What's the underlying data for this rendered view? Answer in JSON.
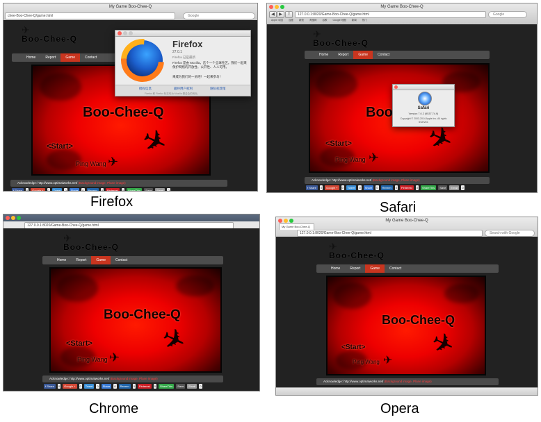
{
  "site": {
    "logo": "Boo-Chee-Q",
    "nav": [
      "Home",
      "Report",
      "Game",
      "Contact"
    ],
    "game_title": "Boo-Chee-Q",
    "start_label": "<Start>",
    "author": "Ping Wang",
    "ack_prefix": "Acknowledge: http://www.optimalworks.net/",
    "ack_suffix": "(Background image, Plane image)",
    "share_buttons": [
      {
        "label": "f Share",
        "color": "#3b5998"
      },
      {
        "label": "0",
        "color": "#eeeeee"
      },
      {
        "label": "Google +",
        "color": "#d34836"
      },
      {
        "label": "0",
        "color": "#eeeeee"
      },
      {
        "label": "Tweet",
        "color": "#3a8ed6"
      },
      {
        "label": "0",
        "color": "#eeeeee"
      },
      {
        "label": "Share",
        "color": "#3a7bd5"
      },
      {
        "label": "0",
        "color": "#eeeeee"
      },
      {
        "label": "Renren",
        "color": "#2266aa"
      },
      {
        "label": "0",
        "color": "#eeeeee"
      },
      {
        "label": "Pinterest",
        "color": "#cb2027"
      },
      {
        "label": "0",
        "color": "#eeeeee"
      },
      {
        "label": "ShareThis",
        "color": "#35a84a"
      },
      {
        "label": "Save",
        "color": "#555555"
      },
      {
        "label": "Email",
        "color": "#999999"
      },
      {
        "label": "0",
        "color": "#eeeeee"
      }
    ]
  },
  "panels": {
    "firefox": {
      "caption": "Firefox",
      "window_title": "My Game Boo-Chee-Q",
      "url": "chee-Boo-Chee-Q/game.html",
      "search_placeholder": "Google",
      "about": {
        "product": "Firefox",
        "version": "27.0.1",
        "channel": "Firefox 已是最新",
        "description": "Firefox 是由 Mozilla，这个一个全球社区。我们一起来保护网络的开放性、公开性、人人可用。",
        "join": "来成为我们的一员吧！一起来参与！",
        "links": [
          "授权信息",
          "最终用户权利",
          "隐私权政策"
        ],
        "footer": "Firefox 和 Firefox 标志均为 Mozilla 基金会的商标。"
      }
    },
    "safari": {
      "caption": "Safari",
      "window_title": "My Game Boo-Chee-Q",
      "url": "127.0.0.1:8020/Game-Boo-Chee-Q/game.html",
      "search_placeholder": "Google",
      "bookmarks": [
        "Apple 中国",
        "百度",
        "新浪",
        "淘宝网",
        "谷歌",
        "Google 地图",
        "新闻",
        "热门"
      ],
      "about": {
        "product": "Safari",
        "version": "Version 7.0.2 (9537.74.9)",
        "copyright": "Copyright © 2003-2014 Apple Inc. All rights reserved."
      }
    },
    "chrome": {
      "caption": "Chrome",
      "url": "127.0.0.1:8020/Game-Boo-Chee-Q/game.html"
    },
    "opera": {
      "caption": "Opera",
      "window_title": "My Game Boo-Chee-Q",
      "tab_title": "My Game Boo-Chee-Q",
      "url": "127.0.0.1:8020/Game-Boo-Chee-Q/game.html",
      "search_placeholder": "Search with Google"
    }
  }
}
